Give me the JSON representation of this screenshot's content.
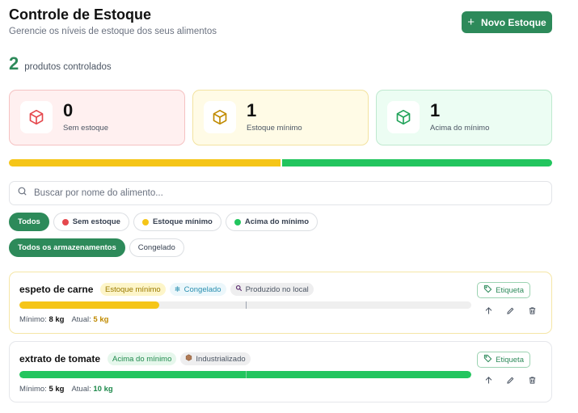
{
  "header": {
    "title": "Controle de Estoque",
    "subtitle": "Gerencie os níveis de estoque dos seus alimentos",
    "new_button_label": "Novo Estoque"
  },
  "summary": {
    "count": "2",
    "count_label": "produtos controlados"
  },
  "stats": [
    {
      "value": "0",
      "label": "Sem estoque",
      "color": "#e5484d"
    },
    {
      "value": "1",
      "label": "Estoque mínimo",
      "color": "#c08a00"
    },
    {
      "value": "1",
      "label": "Acima do mínimo",
      "color": "#22a35a"
    }
  ],
  "distribution": {
    "yellow_share": 0.5,
    "green_share": 0.5,
    "yellow_color": "#f5c518",
    "green_color": "#22c55e"
  },
  "search": {
    "placeholder": "Buscar por nome do alimento..."
  },
  "status_filters": [
    {
      "label": "Todos",
      "active": true
    },
    {
      "label": "Sem estoque",
      "dot": "#e5484d"
    },
    {
      "label": "Estoque mínimo",
      "dot": "#f5c518"
    },
    {
      "label": "Acima do mínimo",
      "dot": "#22c55e"
    }
  ],
  "storage_filters": [
    {
      "label": "Todos os armazenamentos",
      "active": true
    },
    {
      "label": "Congelado"
    }
  ],
  "items": [
    {
      "name": "espeto de carne",
      "status": "Estoque mínimo",
      "storage": "Congelado",
      "origin": "Produzido no local",
      "min_label": "Mínimo:",
      "min_value": "8 kg",
      "current_label": "Atual:",
      "current_value": "5 kg",
      "level": 0.31,
      "min_mark": 0.5,
      "tag_label": "Etiqueta"
    },
    {
      "name": "extrato de tomate",
      "status": "Acima do mínimo",
      "origin": "Industrializado",
      "min_label": "Mínimo:",
      "min_value": "5 kg",
      "current_label": "Atual:",
      "current_value": "10 kg",
      "level": 1.0,
      "min_mark": 0.5,
      "tag_label": "Etiqueta"
    }
  ],
  "colors": {
    "accent": "#2d8a5a"
  }
}
